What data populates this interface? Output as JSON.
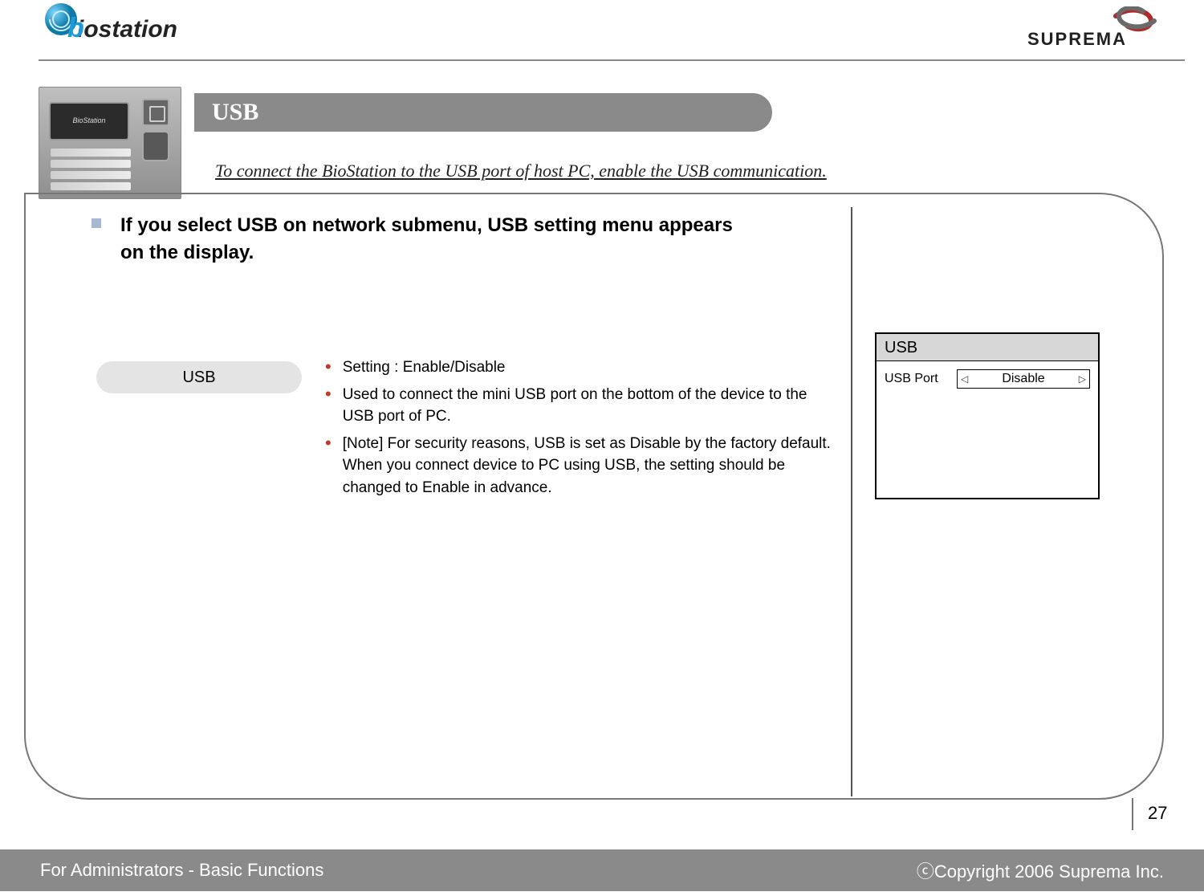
{
  "header": {
    "logo_left": "biostation",
    "logo_right": "SUPREMA"
  },
  "pill_title": "USB",
  "subtitle": "To connect the BioStation to the USB port of host PC, enable the  USB communication.",
  "lead_text": "If you select USB on network submenu, USB setting menu appears on the display.",
  "section_chip": "USB",
  "bullets": [
    "Setting : Enable/Disable",
    "Used to connect the mini USB port on the bottom of the device to the USB port of PC.",
    "[Note] For security reasons, USB is set as Disable by the factory default. When you connect device to PC using USB, the setting should be changed to Enable in advance."
  ],
  "device_screen": {
    "title": "USB",
    "row_label": "USB Port",
    "row_value": "Disable"
  },
  "footer": {
    "left": "For Administrators - Basic Functions",
    "right": "ⓒCopyright 2006 Suprema Inc."
  },
  "page_number": "27"
}
